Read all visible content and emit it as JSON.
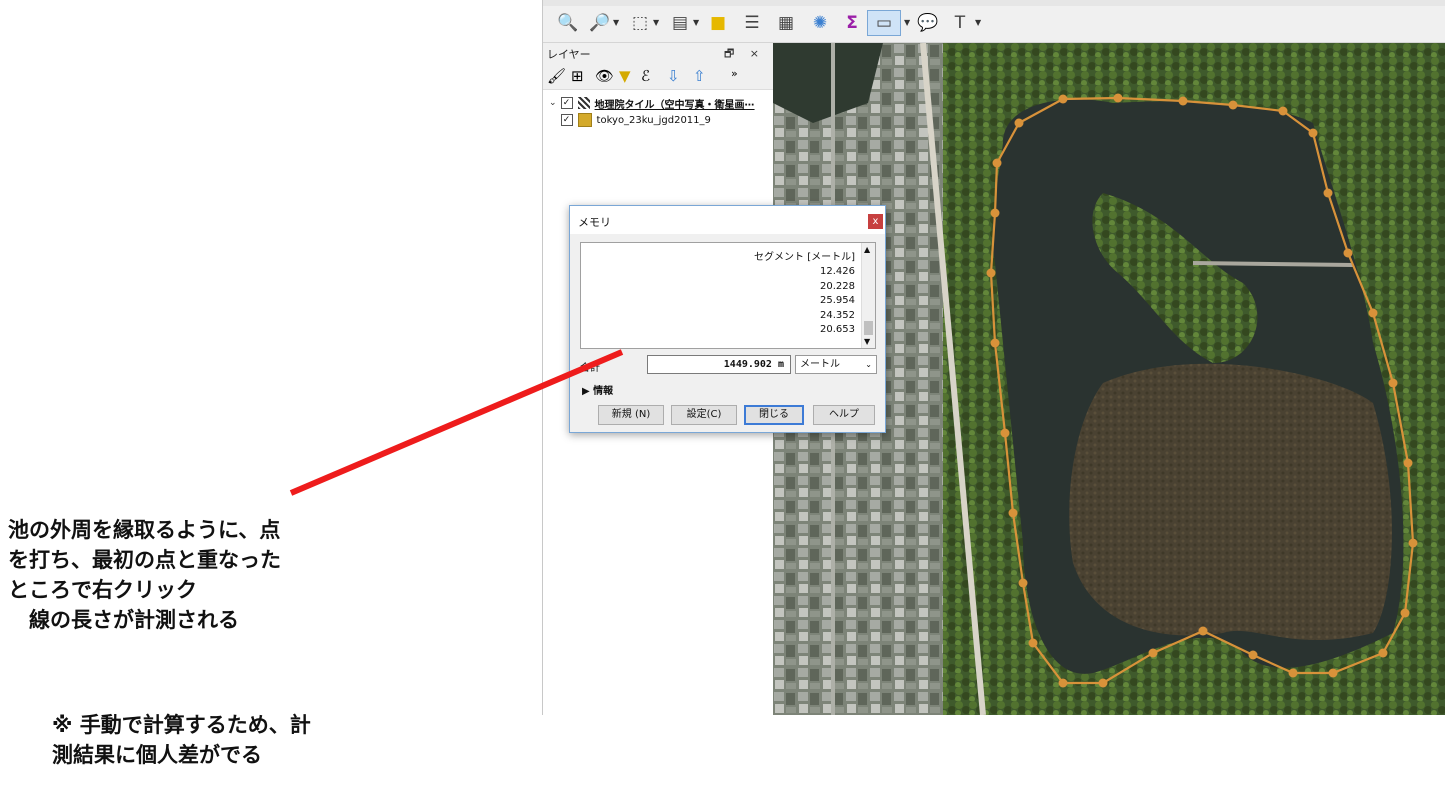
{
  "toolbar": {
    "buttons": [
      "identify-icon",
      "zoom-identify-icon",
      "select-icon",
      "attribute-icon",
      "deselect-icon",
      "attribute-table-icon",
      "field-calculator-icon",
      "settings-icon",
      "statistics-icon",
      "measure-icon",
      "annotation-icon",
      "text-icon"
    ]
  },
  "layers_panel": {
    "title": "レイヤー",
    "controls": "🗗 ×",
    "layers": [
      {
        "name": "地理院タイル（空中写真・衛星画⋯",
        "checked": true
      },
      {
        "name": "tokyo_23ku_jgd2011_9",
        "checked": true
      }
    ]
  },
  "dialog": {
    "title": "メモリ",
    "close": "x",
    "segment_header": "セグメント [メートル]",
    "segments": [
      "12.426",
      "20.228",
      "25.954",
      "24.352",
      "20.653"
    ],
    "total_label": "合計",
    "total_value": "1449.902 m",
    "unit": "メートル",
    "info_label": "▶ 情報",
    "buttons": {
      "new": "新規 (N)",
      "settings": "設定(C)",
      "close": "閉じる",
      "help": "ヘルプ"
    }
  },
  "annotation": {
    "note": "池の外周を縁取るように、点\nを打ち、最初の点と重なった\nところで右クリック\n　線の長さが計測される",
    "caution": "※ 手動で計算するため、計\n測結果に個人差がでる"
  },
  "colors": {
    "arrow": "#ee1c1c",
    "measure_line": "#d8923a",
    "accent": "#3d7bd6"
  }
}
